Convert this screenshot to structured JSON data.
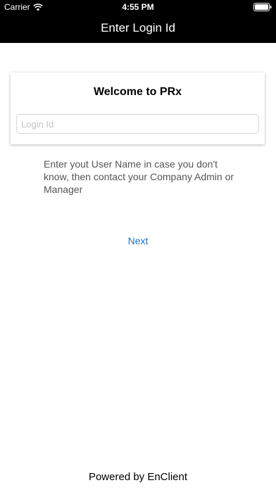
{
  "status_bar": {
    "carrier": "Carrier",
    "time": "4:55 PM",
    "icons": [
      "wifi-icon",
      "battery-icon"
    ]
  },
  "nav": {
    "title": "Enter Login Id"
  },
  "card": {
    "title": "Welcome to PRx",
    "login_input": {
      "placeholder": "Login Id",
      "value": ""
    }
  },
  "help_text": "Enter yout User Name in case you don't know, then contact your Company Admin or Manager",
  "next_label": "Next",
  "footer": "Powered by EnClient",
  "colors": {
    "header_bg": "#000000",
    "link": "#1a73c8",
    "text_secondary": "#555555"
  }
}
